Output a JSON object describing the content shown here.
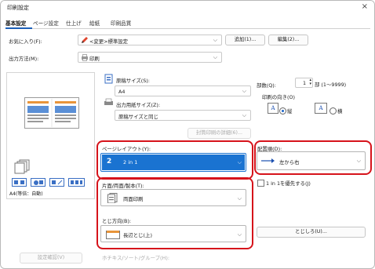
{
  "window": {
    "title": "印刷設定",
    "close_glyph": "×"
  },
  "tabs": [
    "基本設定",
    "ページ設定",
    "仕上げ",
    "給紙",
    "印刷品質"
  ],
  "favorites": {
    "label": "お気に入り(F):",
    "value": "<変更>標準設定",
    "add_button": "追加(1)...",
    "edit_button": "編集(2)..."
  },
  "output_method": {
    "label": "出力方法(M):",
    "value": "印刷"
  },
  "preview": {
    "caption": "A4(等倍：自動)",
    "settings_confirm_button": "設定確認(V)"
  },
  "original_size": {
    "label": "原稿サイズ(S):",
    "value": "A4"
  },
  "output_paper_size": {
    "label": "出力用紙サイズ(Z):",
    "value": "原稿サイズと同じ"
  },
  "envelope_button": "封筒印刷の詳細(6)...",
  "copies": {
    "label": "部数(Q):",
    "value": "1",
    "unit": "部 (1～9999)"
  },
  "orientation": {
    "label": "印刷の向き(O)",
    "portrait": "縦",
    "landscape": "横",
    "selected": "portrait"
  },
  "page_layout": {
    "label": "ページレイアウト(Y):",
    "number": "2",
    "value": "2 in 1",
    "accent": "#1a73d1"
  },
  "layout_order": {
    "label": "配置順(D):",
    "value": "左から右"
  },
  "duplex": {
    "label": "片面/両面/製本(T):",
    "value": "両面印刷"
  },
  "binding_direction": {
    "label": "とじ方向(B):",
    "value": "長辺とじ(上)"
  },
  "prioritize_1in1": {
    "label": "1 in 1を優先する(J)",
    "checked": false
  },
  "binding_button": "とじしろ(U)...",
  "staple_label": "ホチキス/ソート/グループ(H):",
  "colors": {
    "highlight": "#d6131b",
    "selected_bg": "#1a73d1"
  }
}
